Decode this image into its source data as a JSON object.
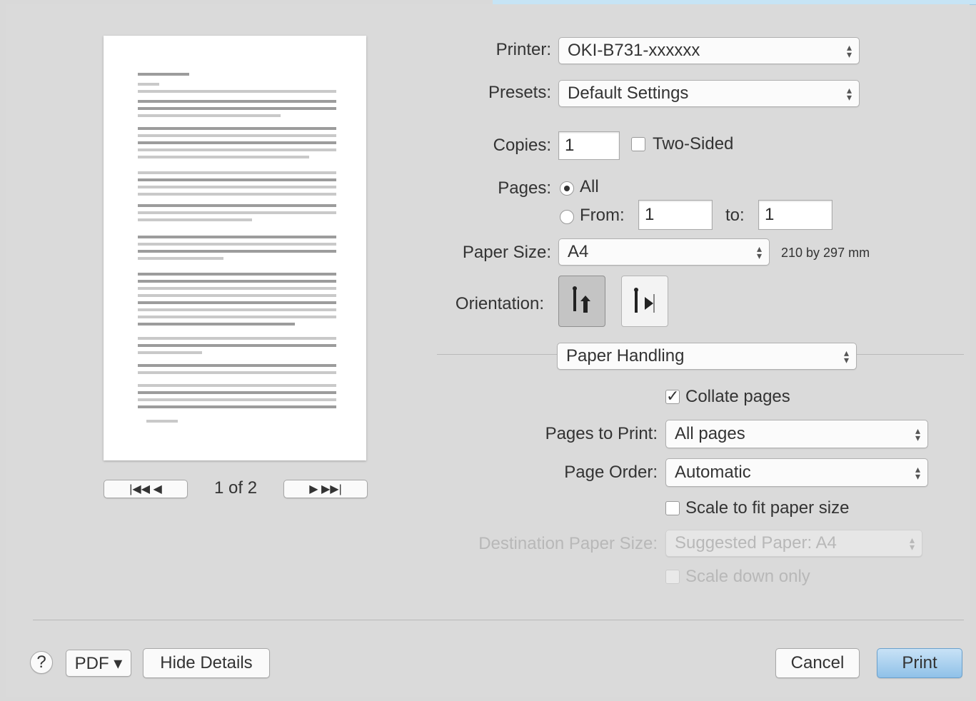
{
  "dialog": {
    "printer": {
      "label": "Printer:",
      "value": "OKI-B731-xxxxxx"
    },
    "presets": {
      "label": "Presets:",
      "value": "Default Settings"
    },
    "copies": {
      "label": "Copies:",
      "value": "1"
    },
    "two_sided": {
      "label": "Two-Sided",
      "checked": false
    },
    "pages": {
      "label": "Pages:",
      "all_label": "All",
      "from_label": "From:",
      "from_value": "1",
      "to_label": "to:",
      "to_value": "1",
      "selected": "All"
    },
    "paper_size": {
      "label": "Paper Size:",
      "value": "A4",
      "dimensions": "210 by 297 mm"
    },
    "orientation": {
      "label": "Orientation:",
      "selected": "portrait"
    },
    "section_popup": {
      "value": "Paper Handling"
    },
    "collate": {
      "label": "Collate pages",
      "checked": true
    },
    "pages_to_print": {
      "label": "Pages to Print:",
      "value": "All pages"
    },
    "page_order": {
      "label": "Page Order:",
      "value": "Automatic"
    },
    "scale_to_fit": {
      "label": "Scale to fit paper size",
      "checked": false
    },
    "destination_paper_size": {
      "label": "Destination Paper Size:",
      "value": "Suggested Paper: A4"
    },
    "scale_down_only": {
      "label": "Scale down only",
      "checked": false
    }
  },
  "preview_nav": {
    "first_prev": "|◀◀  ◀",
    "page_indicator": "1 of 2",
    "next_last": "▶  ▶▶|"
  },
  "footer": {
    "help": "?",
    "pdf": "PDF ▾",
    "hide_details": "Hide Details",
    "cancel": "Cancel",
    "print": "Print"
  },
  "colors": {
    "background": "#dadada",
    "default_button": "#8fc1e8",
    "top_accent": "#c6e4f5"
  },
  "icons": {
    "orientation_portrait": "portrait-orientation-icon",
    "orientation_landscape": "landscape-orientation-icon",
    "popup_arrows": "updown-arrows-icon"
  }
}
